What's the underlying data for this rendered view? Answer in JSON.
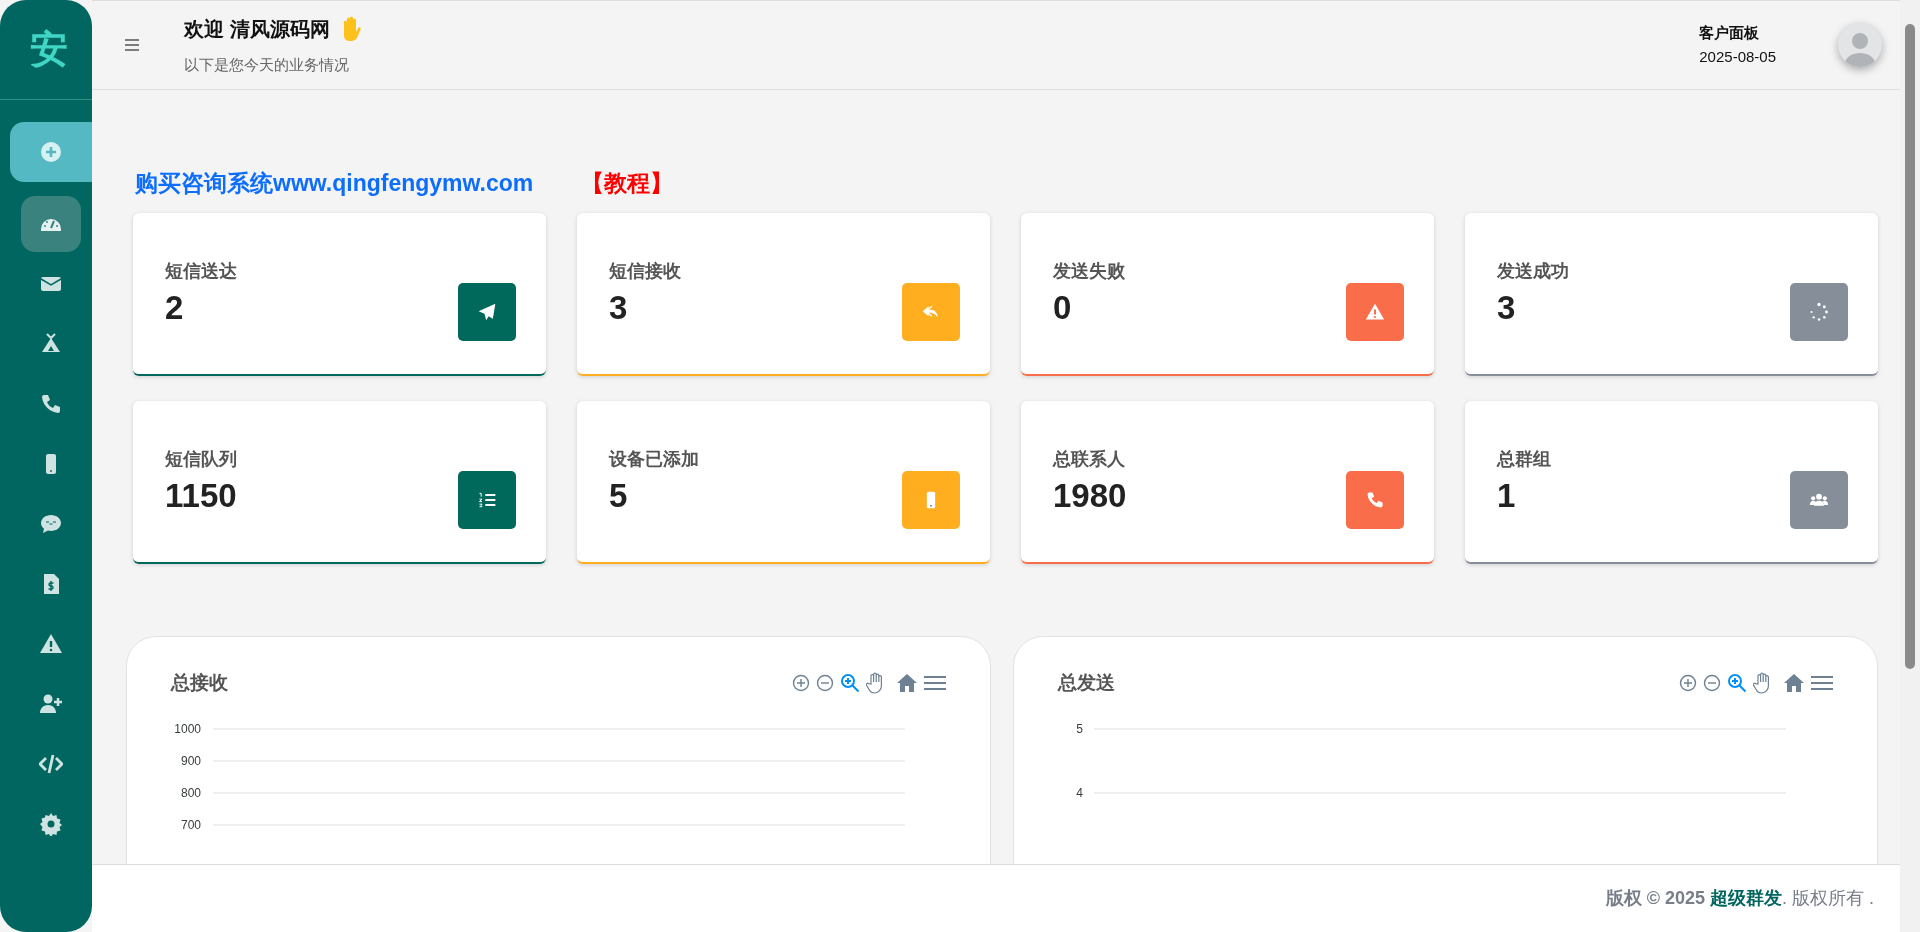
{
  "sidebar": {
    "logo": "安",
    "items": [
      {
        "selected": false,
        "kind": "add"
      },
      {
        "selected": true,
        "kind": "nav"
      },
      {
        "selected": false,
        "kind": "nav"
      },
      {
        "selected": false,
        "kind": "nav"
      },
      {
        "selected": false,
        "kind": "nav"
      },
      {
        "selected": false,
        "kind": "nav"
      },
      {
        "selected": false,
        "kind": "nav"
      },
      {
        "selected": false,
        "kind": "nav"
      },
      {
        "selected": false,
        "kind": "nav"
      },
      {
        "selected": false,
        "kind": "nav"
      },
      {
        "selected": false,
        "kind": "nav"
      },
      {
        "selected": false,
        "kind": "nav"
      }
    ]
  },
  "header": {
    "title": "欢迎 清风源码网",
    "subtitle": "以下是您今天的业务情况",
    "panel_title": "客户面板",
    "date": "2025-08-05"
  },
  "promo": {
    "link": "购买咨询系统www.qingfengymw.com",
    "tutorial": "【教程】"
  },
  "cards": [
    {
      "label": "短信送达",
      "value": "2",
      "color": "#00695c"
    },
    {
      "label": "短信接收",
      "value": "3",
      "color": "#ffae1f"
    },
    {
      "label": "发送失败",
      "value": "0",
      "color": "#fa6d4a"
    },
    {
      "label": "发送成功",
      "value": "3",
      "color": "#868e99"
    },
    {
      "label": "短信队列",
      "value": "1150",
      "color": "#00695c"
    },
    {
      "label": "设备已添加",
      "value": "5",
      "color": "#ffae1f"
    },
    {
      "label": "总联系人",
      "value": "1980",
      "color": "#fa6d4a"
    },
    {
      "label": "总群组",
      "value": "1",
      "color": "#868e99"
    }
  ],
  "charts": [
    {
      "title": "总接收",
      "y_labels": [
        "1000",
        "900",
        "800",
        "700"
      ]
    },
    {
      "title": "总发送",
      "y_labels": [
        "5",
        "4"
      ]
    }
  ],
  "footer": {
    "prefix": "版权 © 2025",
    "brand": "超级群发",
    "suffix": ". 版权所有 ."
  }
}
